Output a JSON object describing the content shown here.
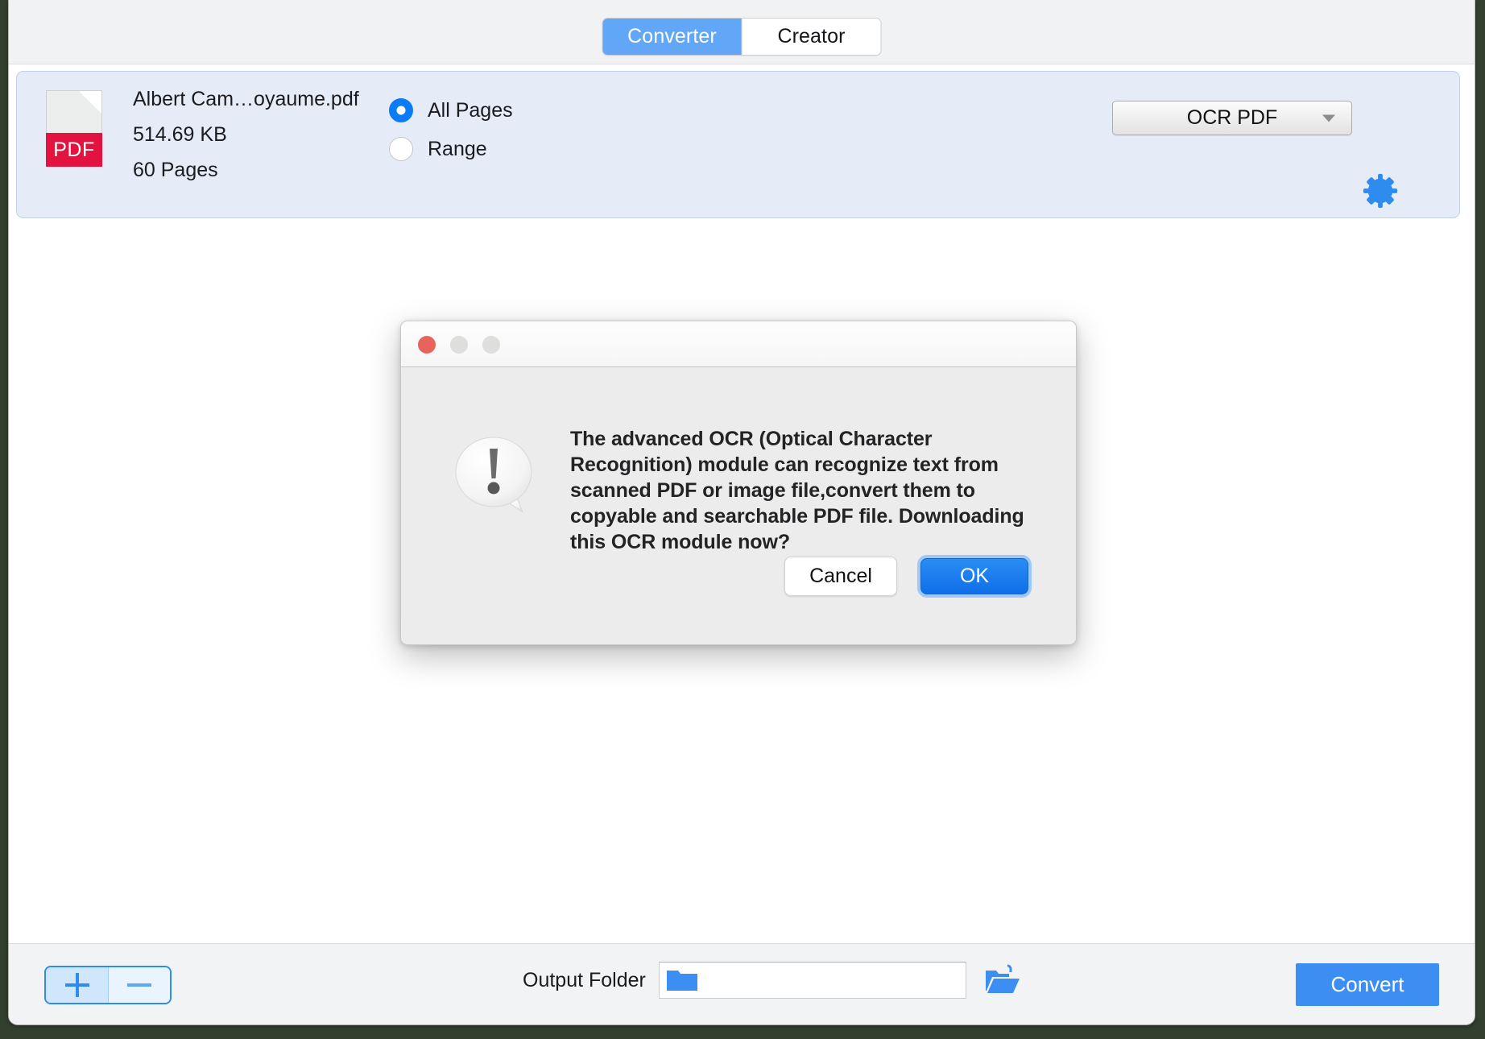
{
  "window": {
    "mode_tabs": [
      {
        "label": "Converter",
        "active": true
      },
      {
        "label": "Creator",
        "active": false
      }
    ]
  },
  "file_row": {
    "icon_badge": "PDF",
    "file_name": "Albert Cam…oyaume.pdf",
    "file_size": "514.69 KB",
    "page_count": "60 Pages",
    "page_range": {
      "options": [
        {
          "label": "All Pages",
          "selected": true
        },
        {
          "label": "Range",
          "selected": false
        }
      ]
    },
    "output_format": {
      "selected": "OCR PDF"
    },
    "settings_icon": "gear-icon"
  },
  "dialog": {
    "title": "",
    "traffic_lights": [
      "close",
      "minimize",
      "zoom"
    ],
    "alert_icon": "exclamation-speech-bubble-icon",
    "message": "The advanced OCR (Optical Character Recognition) module can recognize text from scanned PDF or image file,convert them to copyable and searchable PDF file. Downloading this OCR module now?",
    "cancel_label": "Cancel",
    "ok_label": "OK"
  },
  "bottom_bar": {
    "add_label": "+",
    "remove_label": "−",
    "output_folder_label": "Output Folder",
    "output_folder_value": "",
    "output_folder_placeholder": "",
    "browse_icon": "open-folder-icon",
    "convert_label": "Convert"
  },
  "colors": {
    "accent_blue": "#3d8ef2",
    "tab_active_blue": "#62a6f8",
    "radio_blue": "#0b7cf5",
    "pdf_red": "#e2143f",
    "ok_blue": "#1576ed",
    "card_blue": "#e5ecf8"
  }
}
